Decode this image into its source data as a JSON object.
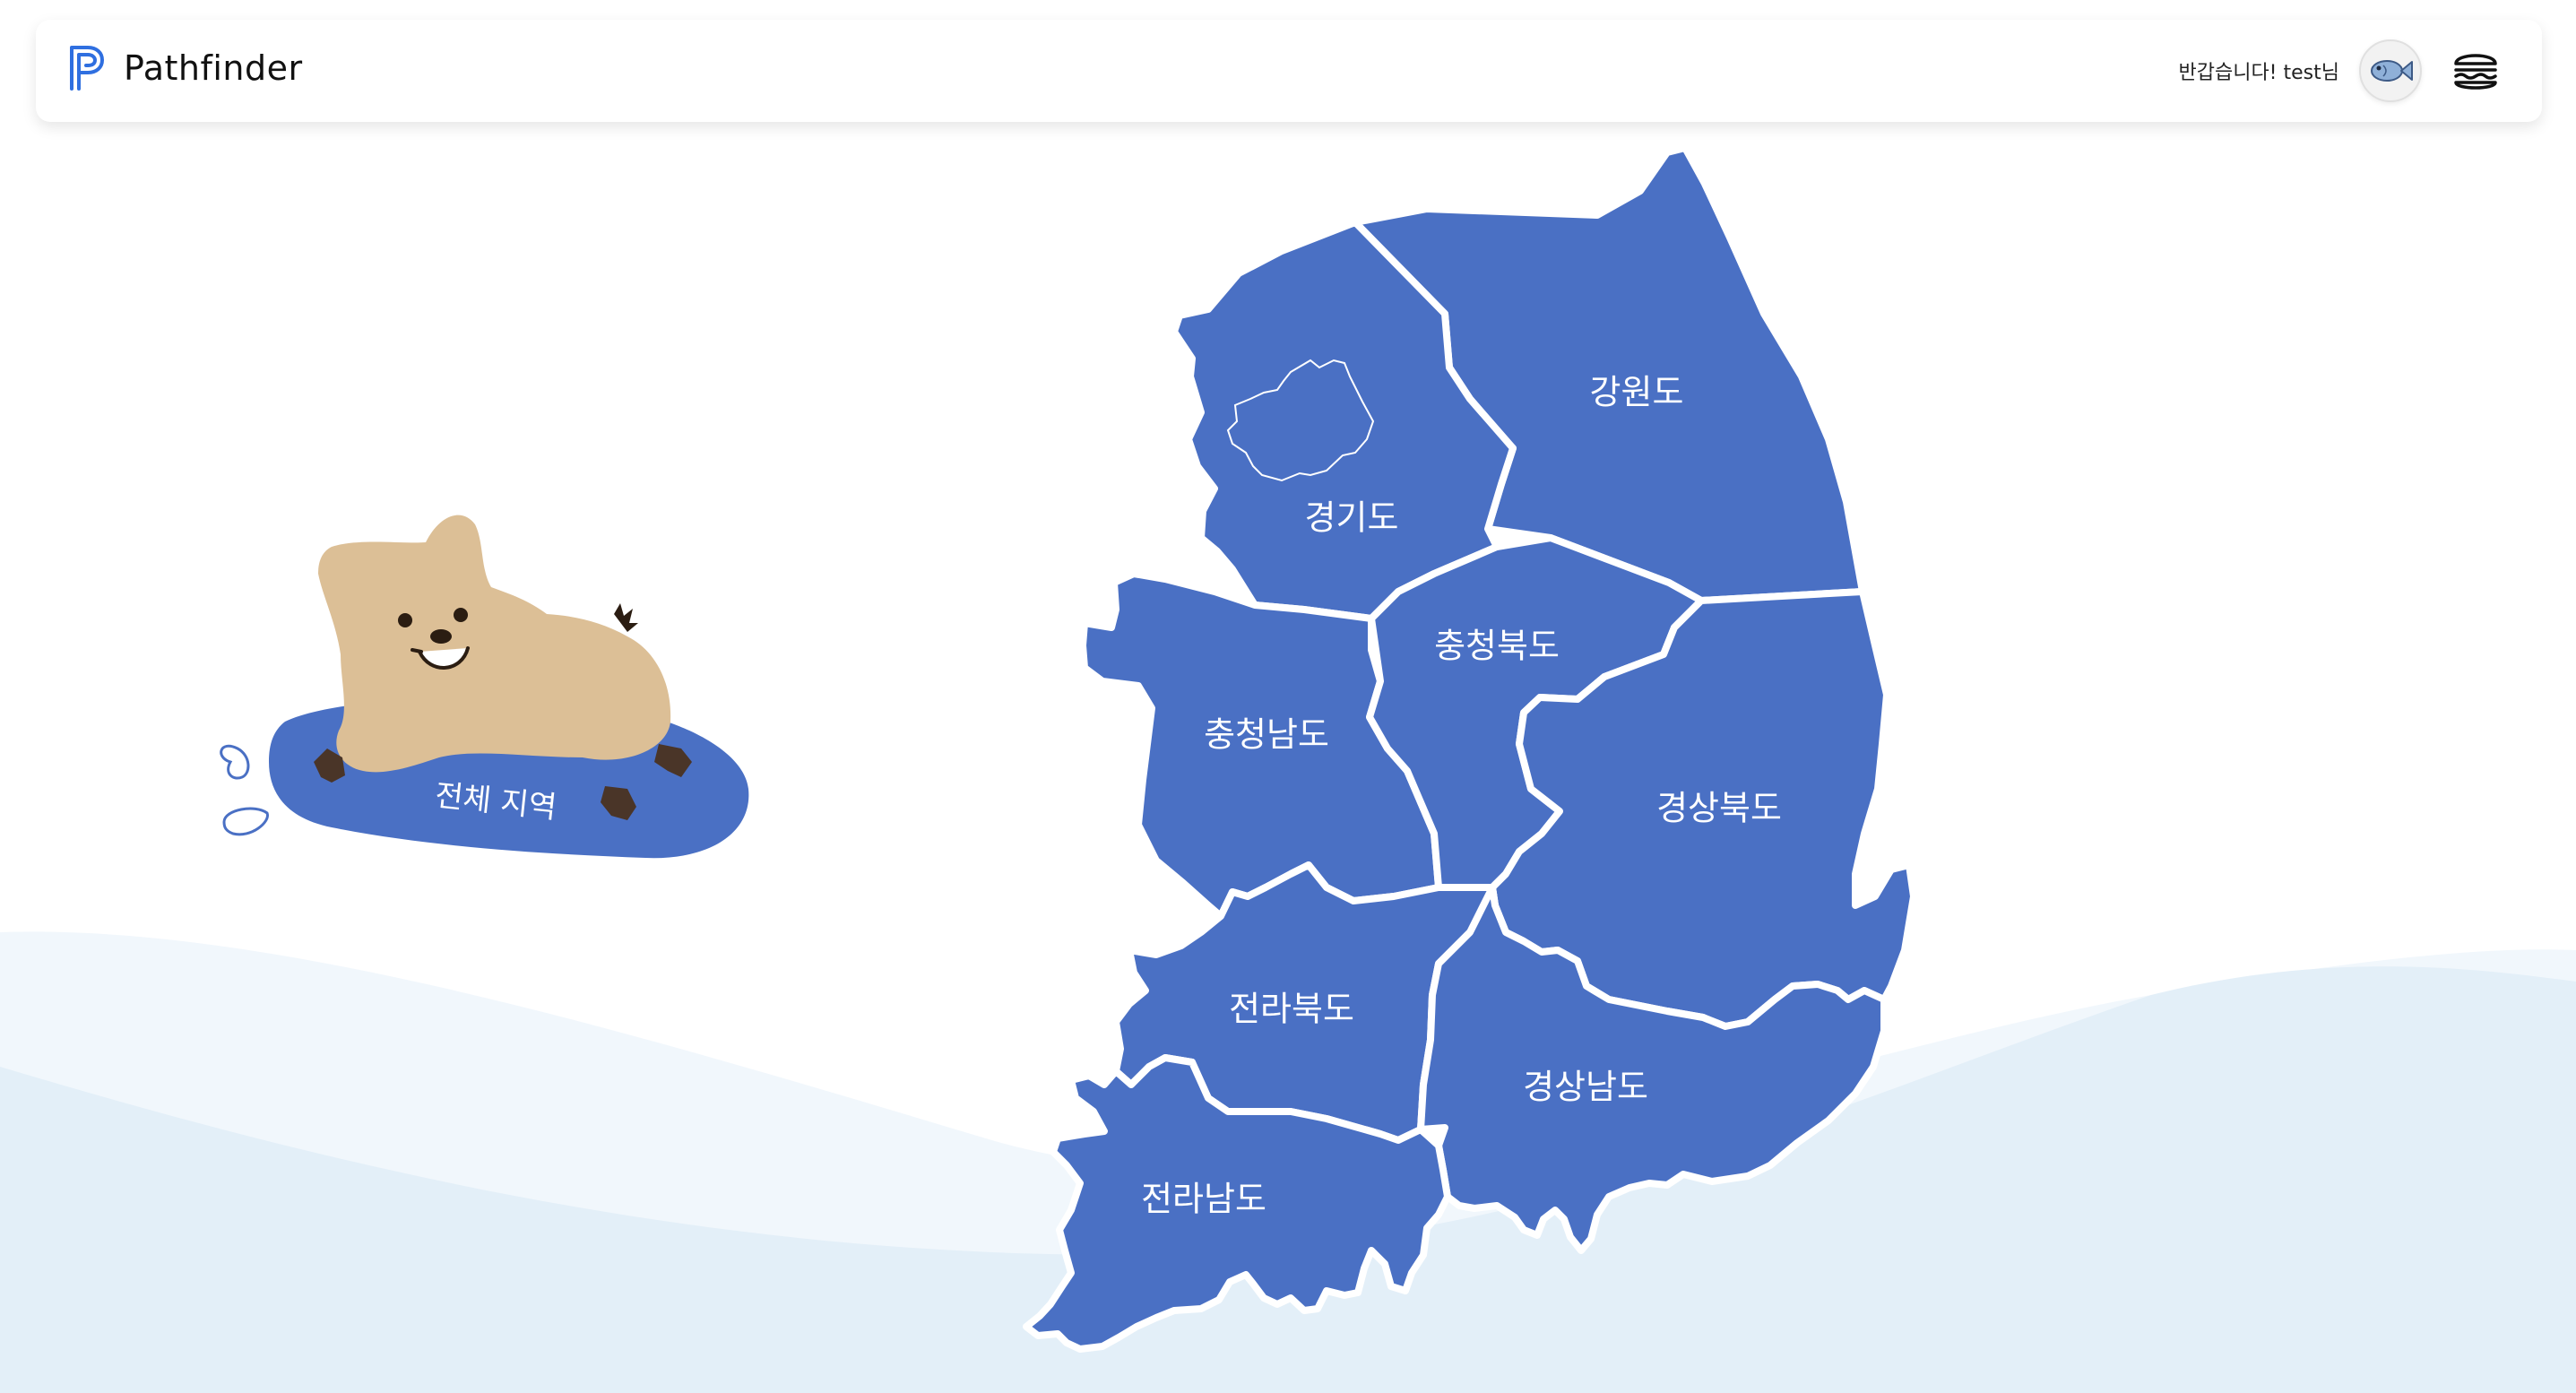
{
  "app": {
    "name": "Pathfinder",
    "logo_icon": "pathfinder-logo-icon",
    "brand_color": "#2f6fe0"
  },
  "header": {
    "greeting": "반갑습니다! test님",
    "avatar_icon": "fish-avatar-icon",
    "menu_icon": "hamburger-menu-icon"
  },
  "all_regions": {
    "label": "전체 지역",
    "mascot": "quokka-mascot"
  },
  "map": {
    "region_color": "#4a70c4",
    "regions": [
      {
        "id": "gyeonggi",
        "label": "경기도"
      },
      {
        "id": "gangwon",
        "label": "강원도"
      },
      {
        "id": "chungbuk",
        "label": "충청북도"
      },
      {
        "id": "chungnam",
        "label": "충청남도"
      },
      {
        "id": "gyeongbuk",
        "label": "경상북도"
      },
      {
        "id": "jeonbuk",
        "label": "전라북도"
      },
      {
        "id": "gyeongnam",
        "label": "경상남도"
      },
      {
        "id": "jeonnam",
        "label": "전라남도"
      }
    ]
  },
  "colors": {
    "wave_light": "#f1f7fc",
    "wave_dark": "#e3eff8"
  }
}
